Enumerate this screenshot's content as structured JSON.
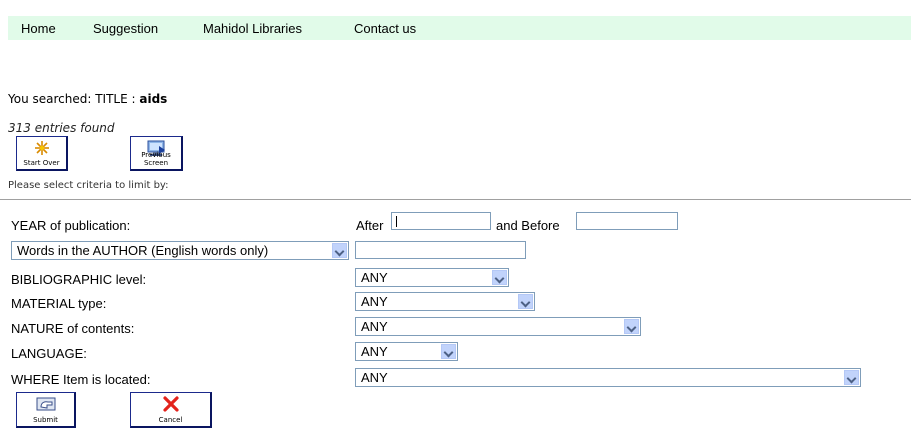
{
  "nav": {
    "items": [
      "Home",
      "Suggestion",
      "Mahidol Libraries",
      "Contact us"
    ]
  },
  "search": {
    "prefix": "You searched: TITLE :",
    "term": "aids",
    "found": "313 entries found",
    "start_over": "Start Over",
    "previous": "Previous Screen",
    "instruction": "Please select criteria to limit by:"
  },
  "form": {
    "year_label": "YEAR of publication:",
    "after_label": "After",
    "before_label": "and Before",
    "author_select": "Words in the AUTHOR (English words only)",
    "bib_label": "BIBLIOGRAPHIC level:",
    "bib_value": "ANY",
    "material_label": "MATERIAL type:",
    "material_value": "ANY",
    "nature_label": "NATURE of contents:",
    "nature_value": "ANY",
    "language_label": "LANGUAGE:",
    "language_value": "ANY",
    "where_label": "WHERE Item is located:",
    "where_value": "ANY",
    "submit": "Submit",
    "cancel": "Cancel"
  }
}
